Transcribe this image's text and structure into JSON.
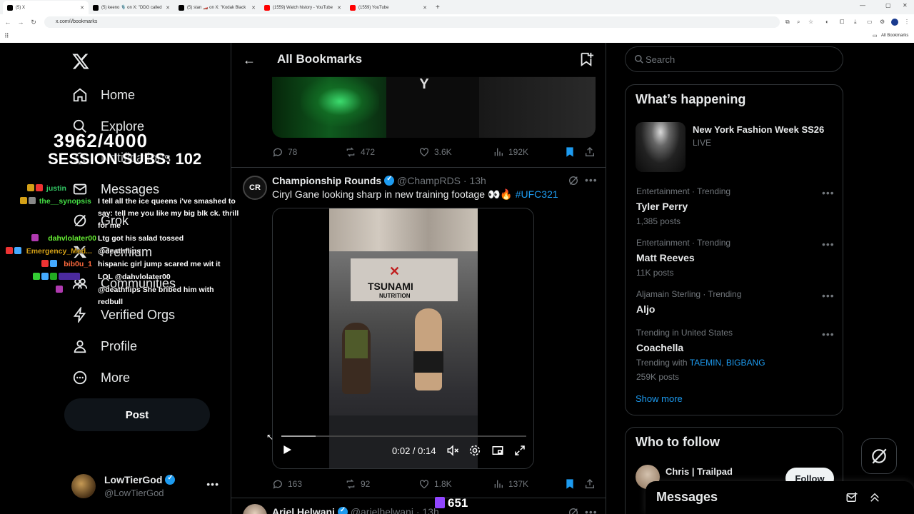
{
  "browser": {
    "tabs": [
      {
        "title": "(5) X",
        "type": "x",
        "active": true
      },
      {
        "title": "(5) keeno 🎙️ on X: \"DDG called",
        "type": "x",
        "active": false
      },
      {
        "title": "(5) stan 🏎️ on X: \"Kodak Black",
        "type": "x",
        "active": false
      },
      {
        "title": "(1559) Watch history - YouTube",
        "type": "yt",
        "active": false
      },
      {
        "title": "(1559) YouTube",
        "type": "yt",
        "active": false
      }
    ],
    "url": "x.com/i/bookmarks",
    "bookmarks_label": "All Bookmarks"
  },
  "nav": {
    "items": [
      {
        "label": "Home",
        "icon": "home-icon"
      },
      {
        "label": "Explore",
        "icon": "search-icon"
      },
      {
        "label": "Notifications",
        "icon": "bell-icon"
      },
      {
        "label": "Messages",
        "icon": "mail-icon"
      },
      {
        "label": "Grok",
        "icon": "grok-icon"
      },
      {
        "label": "Premium",
        "icon": "x-icon"
      },
      {
        "label": "Communities",
        "icon": "people-icon"
      },
      {
        "label": "Verified Orgs",
        "icon": "lightning-icon"
      },
      {
        "label": "Profile",
        "icon": "person-icon"
      },
      {
        "label": "More",
        "icon": "more-circle-icon"
      }
    ],
    "post_label": "Post",
    "account": {
      "name": "LowTierGod",
      "handle": "@LowTierGod"
    }
  },
  "overlay": {
    "sub_count": "3962/4000",
    "session_subs": "SESSION SUBS: 102",
    "chat": [
      {
        "user": "justin",
        "user_color": "#33cc66",
        "msg": ""
      },
      {
        "user": "the__synopsis",
        "user_color": "#44dd44",
        "msg": "I tell all the ice queens i've smashed to say: tell me you like my big blk ck. thrill for me"
      },
      {
        "user": "dahvlolater00",
        "user_color": "#66ee33",
        "msg": "Ltg got his salad tossed"
      },
      {
        "user": "Emergency_Med...",
        "user_color": "#d4a017",
        "msg": "@deathflips"
      },
      {
        "user": "bib0u_1",
        "user_color": "#ff6a3d",
        "msg": "hispanic girl jump scared me wit it"
      },
      {
        "user": "",
        "user_color": "#ffffff",
        "msg": "LOL @dahvlolater00"
      },
      {
        "user": "",
        "user_color": "#ffffff",
        "msg": "@deathflips She bribed him with redbull"
      }
    ],
    "twitch_count": "651"
  },
  "timeline": {
    "title": "All Bookmarks",
    "tweets": [
      {
        "replies": "78",
        "reposts": "472",
        "likes": "3.6K",
        "views": "192K"
      },
      {
        "author": "Championship Rounds",
        "handle": "@ChampRDS",
        "time": "· 13h",
        "text": "Ciryl Gane looking sharp in new training footage 👀🔥",
        "hashtag": "#UFC321",
        "video_time": "0:02 / 0:14",
        "video_progress": 0.14,
        "replies": "163",
        "reposts": "92",
        "likes": "1.8K",
        "views": "137K"
      },
      {
        "author": "Ariel Helwani",
        "handle": "@arielhelwani",
        "time": "· 13h"
      }
    ]
  },
  "right": {
    "search_placeholder": "Search",
    "happening_title": "What’s happening",
    "featured": {
      "title": "New York Fashion Week SS26",
      "label": "LIVE"
    },
    "trends": [
      {
        "category": "Entertainment · Trending",
        "title": "Tyler Perry",
        "count": "1,385 posts"
      },
      {
        "category": "Entertainment · Trending",
        "title": "Matt Reeves",
        "count": "11K posts"
      },
      {
        "category": "Aljamain Sterling · Trending",
        "title": "Aljo",
        "count": ""
      },
      {
        "category": "Trending in United States",
        "title": "Coachella",
        "with_label": "Trending with",
        "with_links": [
          "TAEMIN",
          "BIGBANG"
        ],
        "count": "259K posts"
      }
    ],
    "show_more": "Show more",
    "who_to_follow_title": "Who to follow",
    "follow_suggestion": {
      "name": "Chris | Trailpad",
      "button": "Follow"
    },
    "messages_dock_title": "Messages"
  },
  "colors": {
    "accent": "#1d9bf0",
    "background": "#000000",
    "border": "#2f3336",
    "muted": "#71767b"
  }
}
